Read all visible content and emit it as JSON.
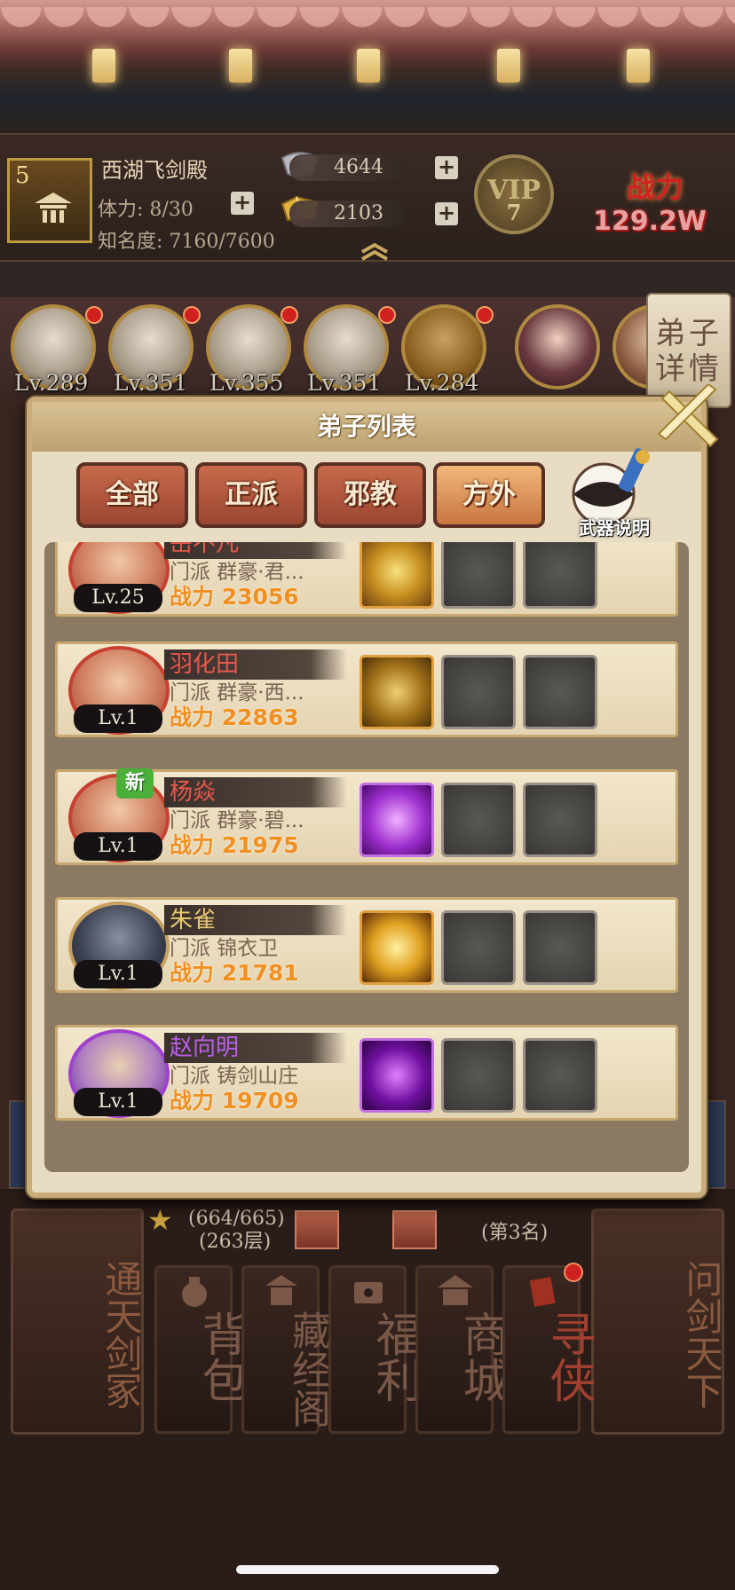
{
  "header": {
    "level": "5",
    "location": "西湖飞剑殿",
    "stamina": "体力: 8/30",
    "fame": "知名度: 7160/7600",
    "silver": "4644",
    "gold": "2103",
    "vip_label": "VIP",
    "vip_level": "7",
    "power_label": "战力",
    "power_value": "129.2W"
  },
  "portraits": [
    {
      "level": "Lv.289"
    },
    {
      "level": "Lv.351"
    },
    {
      "level": "Lv.355"
    },
    {
      "level": "Lv.351"
    },
    {
      "level": "Lv.284"
    },
    {
      "level": ""
    },
    {
      "level": ""
    }
  ],
  "detail_tab": {
    "label": "弟子详情"
  },
  "modal": {
    "title": "弟子列表",
    "tabs": [
      "全部",
      "正派",
      "邪教",
      "方外"
    ],
    "active_tab": "方外",
    "weapon_info": "武器说明",
    "disciples": [
      {
        "name": "岳不凡",
        "level": "Lv.25",
        "sect": "门派   群豪·君...",
        "power": "战力 23056",
        "skill_icon": "golden-swirl-icon",
        "new": false
      },
      {
        "name": "羽化田",
        "level": "Lv.1",
        "sect": "门派   群豪·西...",
        "power": "战力 22863",
        "skill_icon": "golden-dragon-icon",
        "new": false
      },
      {
        "name": "杨焱",
        "level": "Lv.1",
        "sect": "门派   群豪·碧...",
        "power": "战力 21975",
        "skill_icon": "purple-vortex-icon",
        "new": true,
        "new_label": "新"
      },
      {
        "name": "朱雀",
        "level": "Lv.1",
        "sect": "门派   锦衣卫",
        "power": "战力 21781",
        "skill_icon": "golden-horse-icon",
        "new": false
      },
      {
        "name": "赵向明",
        "level": "Lv.1",
        "sect": "门派   铸剑山庄",
        "power": "战力 19709",
        "skill_icon": "purple-figure-icon",
        "new": false
      }
    ]
  },
  "bottom": {
    "tower_progress": "(664/665)",
    "tower_floor": "(263层)",
    "rank": "(第3名)",
    "left_button": "通天剑冢",
    "right_button": "问剑天下",
    "nav": [
      "背包",
      "藏经阁",
      "福利",
      "商城",
      "寻侠"
    ]
  },
  "colors": {
    "accent_red": "#e8584c",
    "power_orange": "#f09020",
    "purple_quality": "#b860e8",
    "modal_bg": "#e8dcc2"
  }
}
